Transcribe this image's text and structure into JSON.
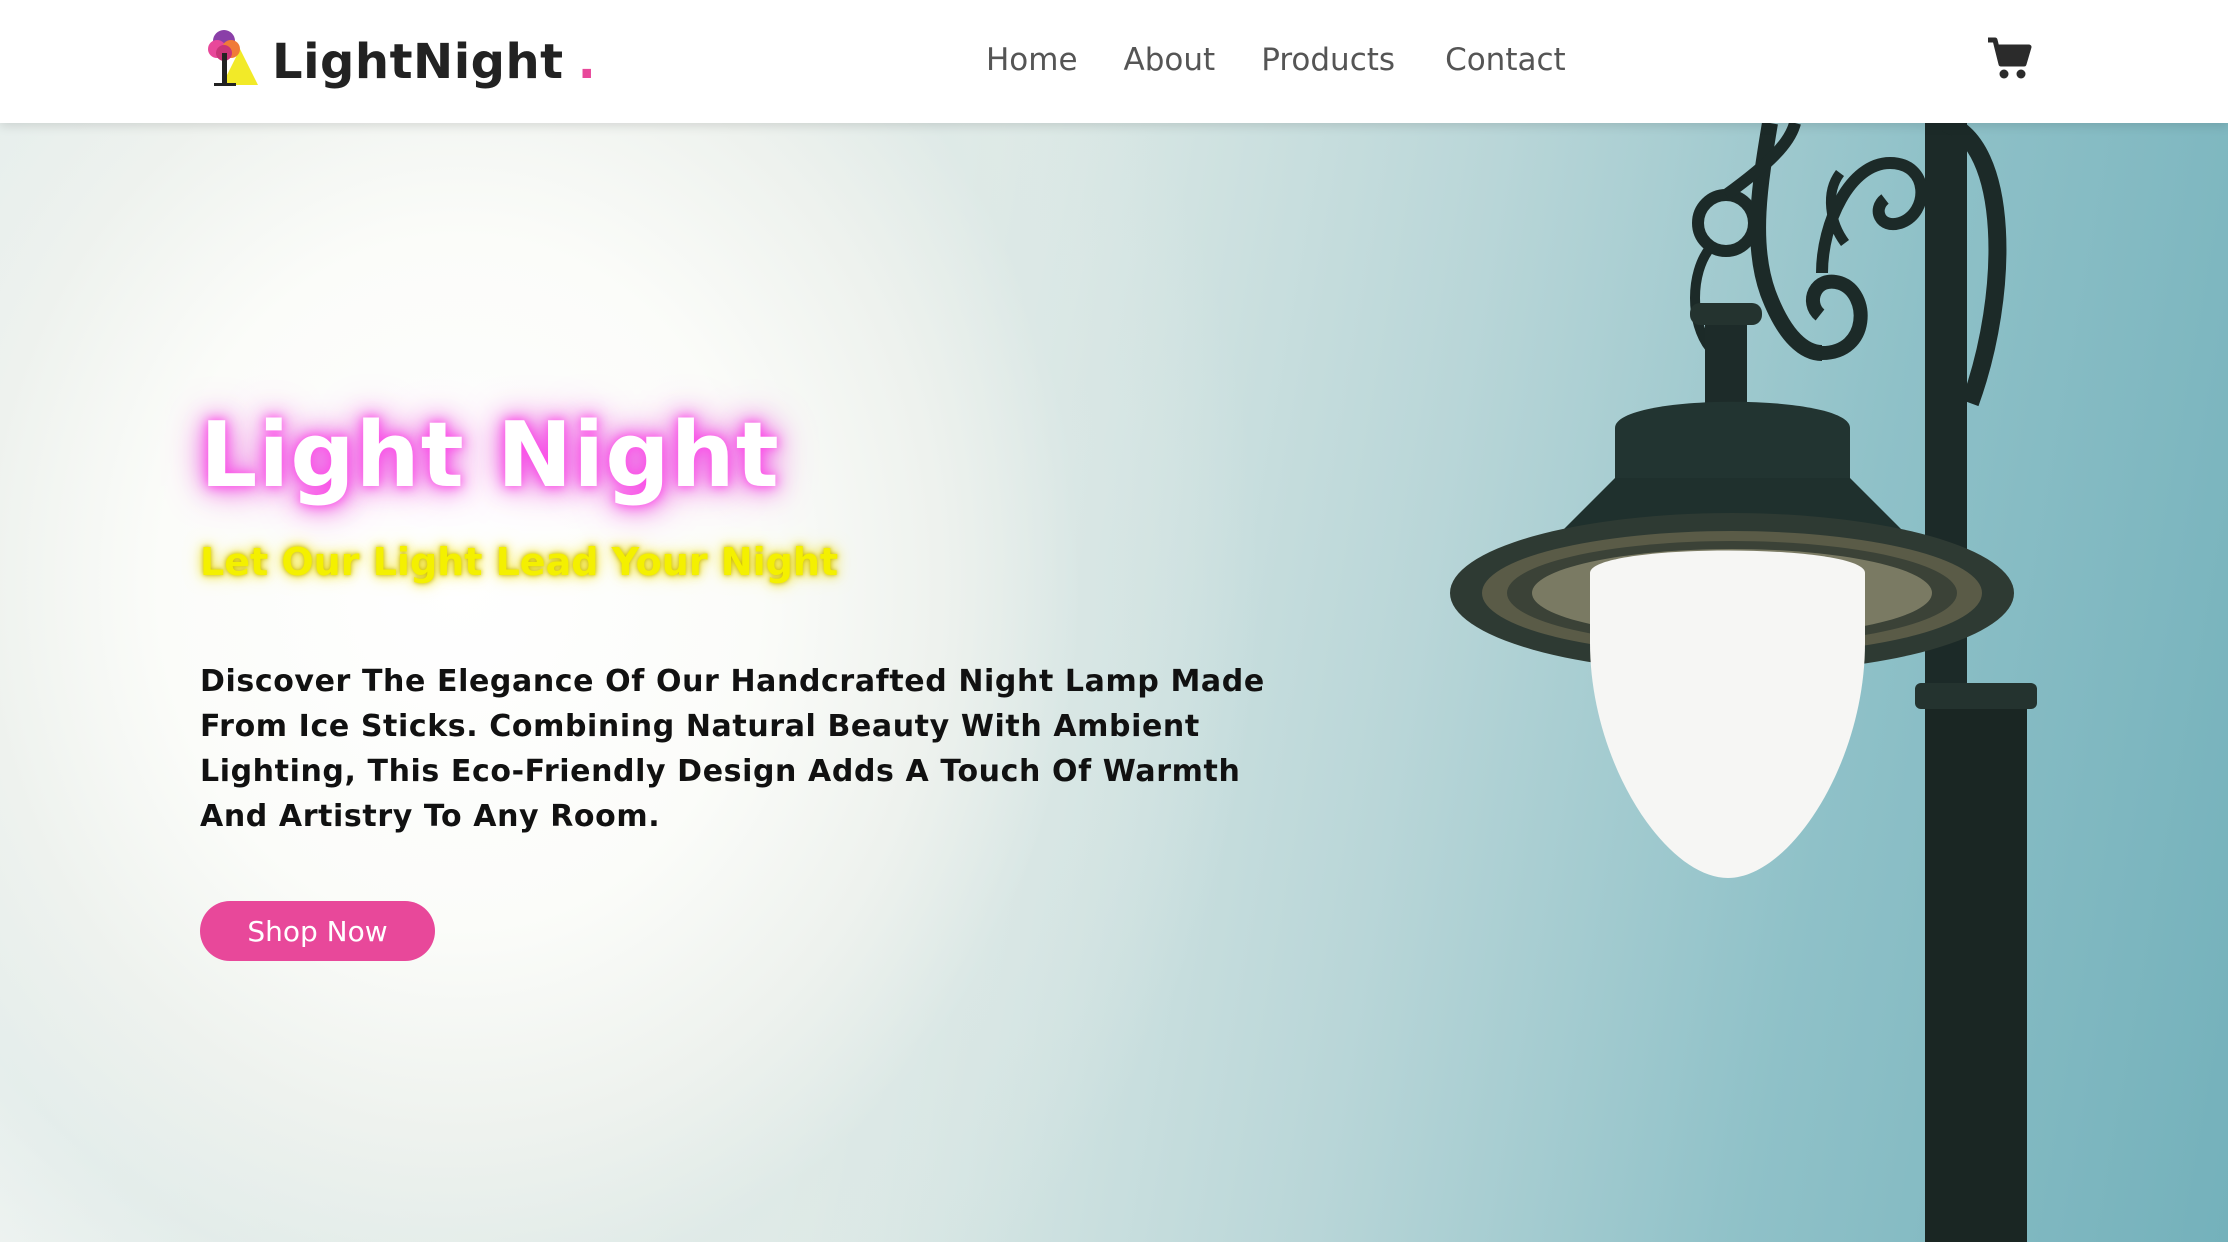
{
  "header": {
    "brand_name": "LightNight",
    "brand_dot": ".",
    "nav": [
      "Home",
      "About",
      "Products",
      "Contact"
    ]
  },
  "hero": {
    "title": "Light Night",
    "subtitle": "Let Our Light Lead Your Night",
    "description": "Discover The Elegance Of Our Handcrafted Night Lamp Made From Ice Sticks. Combining Natural Beauty With Ambient Lighting, This Eco-Friendly Design Adds A Touch Of Warmth And Artistry To Any Room.",
    "cta_label": "Shop Now"
  },
  "icons": {
    "logo": "tree-lamp-logo-icon",
    "cart": "cart-icon"
  },
  "colors": {
    "accent": "#e8489a",
    "brand_dot": "#e8489a",
    "subtitle": "#f4f000",
    "title_glow": "#f04ae6"
  }
}
